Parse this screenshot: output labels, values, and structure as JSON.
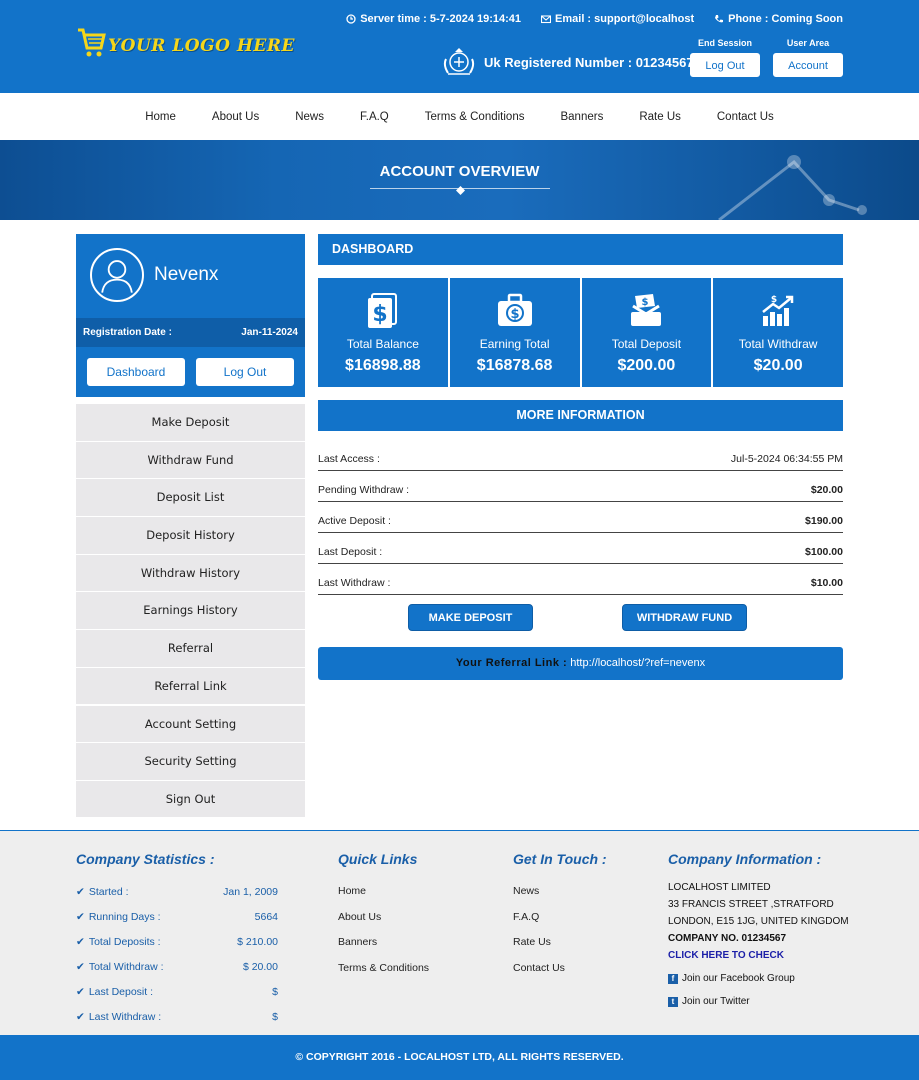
{
  "header": {
    "logo_text": "YOUR LOGO HERE",
    "server_time": "Server time : 5-7-2024 19:14:41",
    "email": "Email : support@localhost",
    "phone": "Phone : Coming Soon",
    "registered": "Uk Registered Number : 01234567",
    "end_session_label": "End Session",
    "logout_label": "Log Out",
    "user_area_label": "User Area",
    "account_label": "Account"
  },
  "nav": {
    "items": [
      "Home",
      "About Us",
      "News",
      "F.A.Q",
      "Terms & Conditions",
      "Banners",
      "Rate Us",
      "Contact Us"
    ]
  },
  "banner": {
    "title": "ACCOUNT OVERVIEW"
  },
  "profile": {
    "username": "Nevenx",
    "reg_label": "Registration Date :",
    "reg_date": "Jan-11-2024",
    "dashboard_button": "Dashboard",
    "logout_button": "Log Out"
  },
  "sidebar": {
    "items": [
      "Make Deposit",
      "Withdraw Fund",
      "Deposit List",
      "Deposit History",
      "Withdraw History",
      "Earnings History",
      "Referral",
      "Referral Link",
      "Account Setting",
      "Security Setting",
      "Sign Out"
    ]
  },
  "dashboard": {
    "title": "DASHBOARD",
    "stats": [
      {
        "label": "Total Balance",
        "value": "$16898.88",
        "icon": "money-icon"
      },
      {
        "label": "Earning Total",
        "value": "$16878.68",
        "icon": "briefcase-dollar-icon"
      },
      {
        "label": "Total Deposit",
        "value": "$200.00",
        "icon": "deposit-icon"
      },
      {
        "label": "Total Withdraw",
        "value": "$20.00",
        "icon": "growth-chart-icon"
      }
    ]
  },
  "more_info": {
    "title": "MORE INFORMATION",
    "rows": [
      {
        "label": "Last Access :",
        "value": "Jul-5-2024 06:34:55 PM"
      },
      {
        "label": "Pending Withdraw :",
        "value": "$20.00"
      },
      {
        "label": "Active Deposit :",
        "value": "$190.00"
      },
      {
        "label": "Last Deposit :",
        "value": "$100.00"
      },
      {
        "label": "Last Withdraw :",
        "value": "$10.00"
      }
    ],
    "make_deposit_button": "MAKE DEPOSIT",
    "withdraw_button": "WITHDRAW FUND",
    "referral_label": "Your Referral Link :",
    "referral_url": "http://localhost/?ref=nevenx"
  },
  "footer": {
    "stats_title": "Company Statistics :",
    "stats": [
      {
        "label": "Started :",
        "value": "Jan 1, 2009"
      },
      {
        "label": "Running Days :",
        "value": "5664"
      },
      {
        "label": "Total Deposits :",
        "value": "$ 210.00"
      },
      {
        "label": "Total Withdraw :",
        "value": "$ 20.00"
      },
      {
        "label": "Last Deposit :",
        "value": "$"
      },
      {
        "label": "Last Withdraw :",
        "value": "$"
      }
    ],
    "quick_title": "Quick Links",
    "quick_links": [
      "Home",
      "About Us",
      "Banners",
      "Terms & Conditions"
    ],
    "touch_title": "Get In Touch :",
    "touch_links": [
      "News",
      "F.A.Q",
      "Rate Us",
      "Contact Us"
    ],
    "company_title": "Company Information :",
    "company_lines": [
      "LOCALHOST LIMITED",
      "33 FRANCIS STREET ,STRATFORD",
      "LONDON, E15 1JG, UNITED KINGDOM"
    ],
    "company_no": "COMPANY NO. 01234567",
    "check_link": "CLICK HERE TO CHECK",
    "facebook": "Join our Facebook Group",
    "twitter": "Join our Twitter",
    "copyright": "© COPYRIGHT 2016 - LOCALHOST LTD, ALL RIGHTS RESERVED."
  },
  "colors": {
    "primary": "#1273c9",
    "logo": "#f5d61a",
    "menu_bg": "#e9e8ea",
    "footer_bg": "#eeeeee"
  }
}
